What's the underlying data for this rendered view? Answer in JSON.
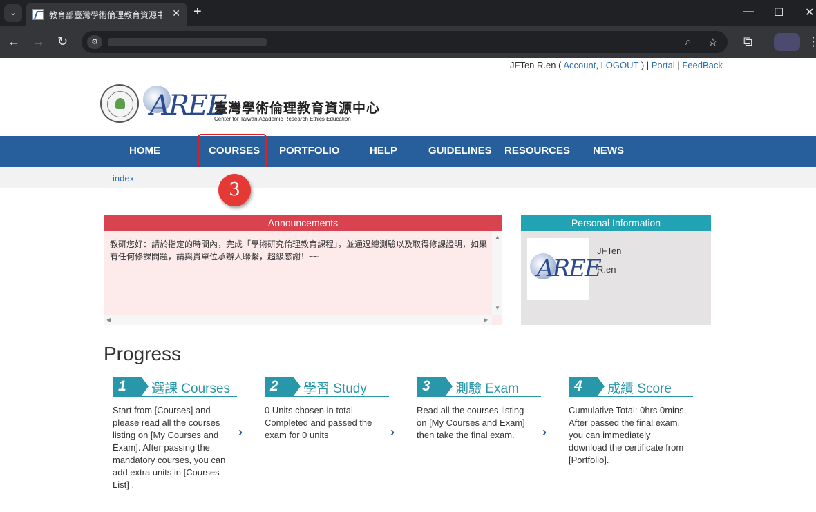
{
  "browser": {
    "tab_title": "教育部臺灣學術倫理教育資源中心",
    "tab_dropdown": "⌄",
    "tab_close": "✕",
    "new_tab": "+",
    "window_minimize": "—",
    "window_maximize": "☐",
    "window_close": "✕",
    "back_icon": "←",
    "forward_icon": "→",
    "reload_icon": "↻",
    "zoom_icon": "⌕",
    "bookmark_icon": "☆",
    "extensions_icon": "⧉",
    "menu_icon": "⋮",
    "site_info_icon": "⚙"
  },
  "user_bar": {
    "name": "JFTen R.en",
    "open_paren": " ( ",
    "account": "Account",
    "comma": ", ",
    "logout": "LOGOUT",
    "close_sep": " ) | ",
    "portal": "Portal",
    "sep": " | ",
    "feedback": "FeedBack"
  },
  "logo": {
    "mark": "AREE",
    "name_cn": "臺灣學術倫理教育資源中心",
    "name_en": "Center for Taiwan Academic Research Ethics Education"
  },
  "nav": {
    "items": [
      "HOME",
      "COURSES",
      "PORTFOLIO",
      "HELP",
      "GUIDELINES",
      "RESOURCES",
      "NEWS"
    ]
  },
  "breadcrumb": "index",
  "step_marker": "3",
  "announcements": {
    "title": "Announcements",
    "text": "教研您好：請於指定的時間內，完成「學術研究倫理教育課程」，並通過總測驗以及取得修課證明，如果有任何修課問題，請與貴單位承辦人聯繫，超級感謝！~~"
  },
  "personal_info": {
    "title": "Personal Information",
    "first_name": "JFTen",
    "last_name": "R.en",
    "avatar_mark": "AREE"
  },
  "progress": {
    "title": "Progress",
    "steps": [
      {
        "num": "1",
        "label": "選課 Courses",
        "desc": "Start from [Courses] and please read all the courses listing on [My Courses and Exam]. After passing the mandatory courses, you can add extra units in [Courses List] ."
      },
      {
        "num": "2",
        "label": "學習 Study",
        "desc": "0 Units chosen in total Completed and passed the exam for 0 units"
      },
      {
        "num": "3",
        "label": "測驗 Exam",
        "desc": "Read all the courses listing on [My Courses and Exam] then take the final exam."
      },
      {
        "num": "4",
        "label": "成績 Score",
        "desc": "Cumulative Total: 0hrs 0mins. After passed the final exam, you can immediately download the certificate from [Portfolio]."
      }
    ],
    "chevron": "›"
  },
  "colors": {
    "nav_bg": "#275f9c",
    "announce_header": "#d9434f",
    "announce_body": "#fdeaea",
    "info_header": "#22a3b4",
    "step_accent": "#2797a9",
    "highlight": "#e02020"
  }
}
